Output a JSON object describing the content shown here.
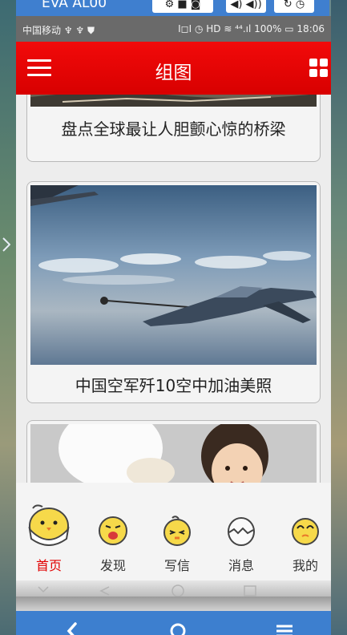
{
  "emulator": {
    "title": "EVA AL00",
    "btn1": "⚙ ■ ◙",
    "btn2": "◀) ◀))",
    "btn3": "↻ ◷"
  },
  "statusbar": {
    "left": "中国移动 ♆ ♆ ⛊",
    "right": "I◻I ◷ HD ≋ ⁴⁴.ıl 100% ▭ 18:06"
  },
  "appbar": {
    "title": "组图"
  },
  "feed": {
    "cards": [
      {
        "caption": "盘点全球最让人胆颤心惊的桥梁"
      },
      {
        "caption": "中国空军歼10空中加油美照"
      },
      {
        "caption": ""
      }
    ]
  },
  "tabs": [
    {
      "label": "首页",
      "icon": "chick-home-icon"
    },
    {
      "label": "发现",
      "icon": "chick-discover-icon"
    },
    {
      "label": "写信",
      "icon": "chick-write-icon"
    },
    {
      "label": "消息",
      "icon": "egg-message-icon"
    },
    {
      "label": "我的",
      "icon": "chick-mine-icon"
    }
  ],
  "colors": {
    "accent": "#e10000",
    "appbar": "#f20a0a",
    "nav": "#3d7fcf"
  }
}
